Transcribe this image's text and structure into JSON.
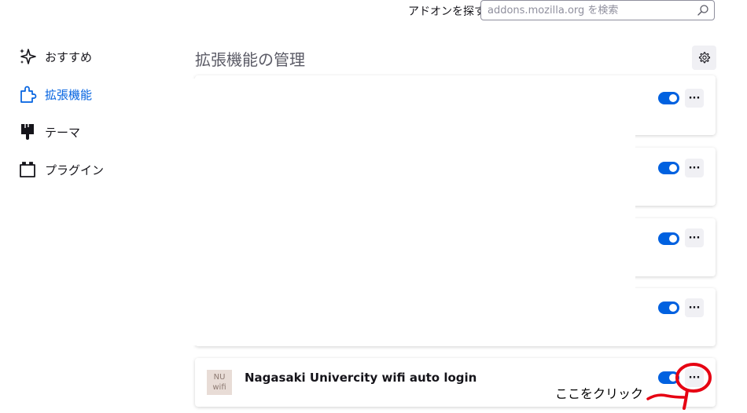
{
  "search": {
    "label": "アドオンを探す",
    "placeholder": "addons.mozilla.org を検索"
  },
  "sidebar": {
    "items": [
      {
        "label": "おすすめ",
        "icon": "sparkle-icon",
        "active": false
      },
      {
        "label": "拡張機能",
        "icon": "puzzle-icon",
        "active": true
      },
      {
        "label": "テーマ",
        "icon": "brush-icon",
        "active": false
      },
      {
        "label": "プラグイン",
        "icon": "plugin-icon",
        "active": false
      }
    ]
  },
  "main": {
    "title": "拡張機能の管理",
    "extensions": [
      {
        "name": "",
        "enabled": true
      },
      {
        "name": "",
        "enabled": true
      },
      {
        "name": "",
        "enabled": true
      },
      {
        "name": "",
        "enabled": true
      },
      {
        "name": "Nagasaki Univercity wifi auto login",
        "enabled": true,
        "icon_text": [
          "NU",
          "wifi"
        ]
      }
    ],
    "more_label": "···"
  },
  "annotation": {
    "text": "ここをクリック",
    "color": "#e60012"
  },
  "colors": {
    "accent": "#0061e0",
    "button_bg": "#f0f0f4"
  }
}
